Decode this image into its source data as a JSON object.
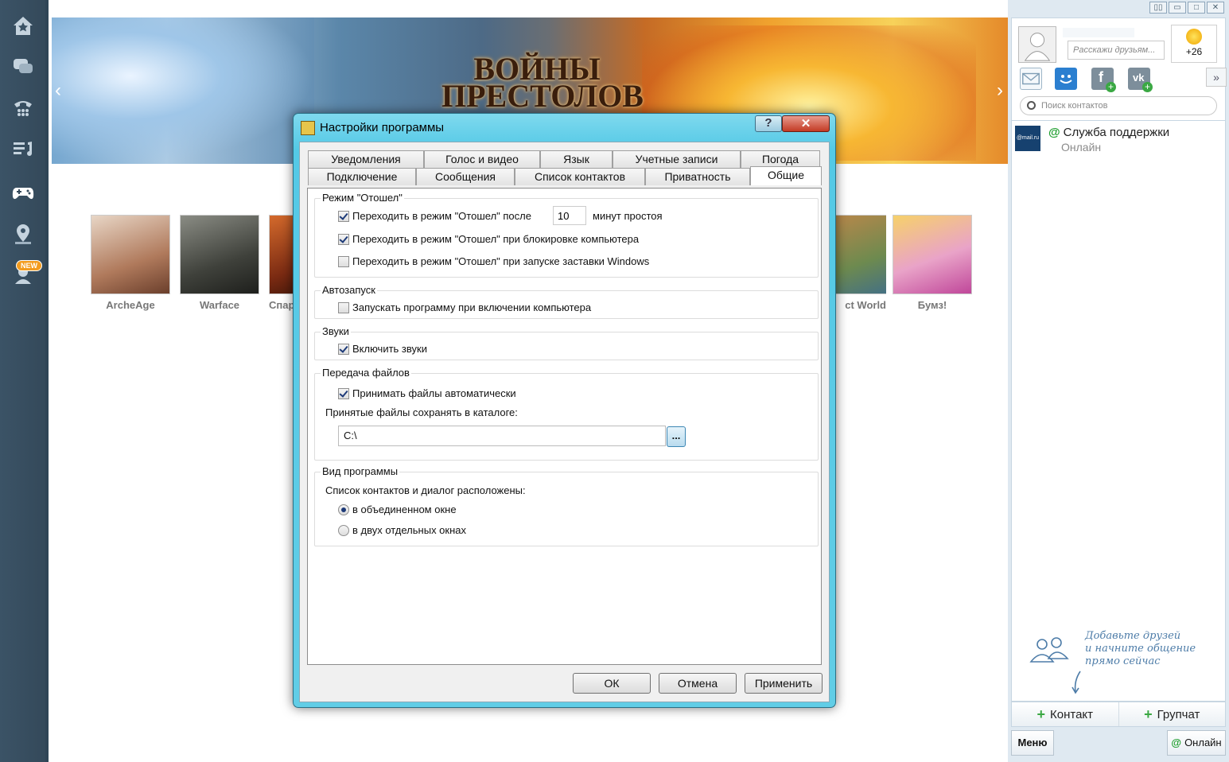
{
  "nav": {
    "new_badge": "NEW"
  },
  "banner": {
    "title_line1": "ВОЙНЫ",
    "title_line2": "ПРЕСТОЛОВ"
  },
  "games": [
    {
      "name": "ArcheAge",
      "color": "#c9a78c"
    },
    {
      "name": "Warface",
      "color": "#54574f"
    },
    {
      "name": "Спар",
      "color": "#8a3a1a"
    },
    {
      "name": "ct World",
      "color": "#6d8a4f"
    },
    {
      "name": "Бумз!",
      "color": "#e9a3c8"
    }
  ],
  "right_panel": {
    "status_placeholder": "Расскажи друзьям...",
    "weather_temp": "+26",
    "search_placeholder": "Поиск контактов",
    "contact": {
      "logo": "@mail.ru",
      "name": "Служба поддержки",
      "status": "Онлайн"
    },
    "hint": [
      "Добавьте друзей",
      "и начните общение",
      "прямо сейчас"
    ],
    "add_contact": "Контакт",
    "add_groupchat": "Групчат",
    "menu": "Меню",
    "online": "Онлайн"
  },
  "dialog": {
    "title": "Настройки программы",
    "help_label": "?",
    "close_label": "✕",
    "tabs_row1": [
      "Уведомления",
      "Голос и видео",
      "Язык",
      "Учетные записи",
      "Погода"
    ],
    "tabs_row2": [
      "Подключение",
      "Сообщения",
      "Список контактов",
      "Приватность",
      "Общие"
    ],
    "away": {
      "title": "Режим \"Отошел\"",
      "opt1": "Переходить в режим \"Отошел\" после",
      "opt1_checked": true,
      "minutes": "10",
      "minutes_suffix": "минут простоя",
      "opt2": "Переходить в режим \"Отошел\" при блокировке компьютера",
      "opt2_checked": true,
      "opt3": "Переходить в режим \"Отошел\" при запуске заставки Windows",
      "opt3_checked": false
    },
    "autostart": {
      "title": "Автозапуск",
      "opt": "Запускать программу при включении компьютера",
      "checked": false
    },
    "sounds": {
      "title": "Звуки",
      "opt": "Включить звуки",
      "checked": true
    },
    "files": {
      "title": "Передача файлов",
      "opt": "Принимать файлы автоматически",
      "checked": true,
      "dir_label": "Принятые файлы сохранять в каталоге:",
      "dir_value": "C:\\",
      "browse": "..."
    },
    "view": {
      "title": "Вид программы",
      "label": "Список контактов и диалог расположены:",
      "opt1": "в объединенном окне",
      "opt2": "в двух отдельных окнах",
      "selected": 1
    },
    "buttons": {
      "ok": "ОК",
      "cancel": "Отмена",
      "apply": "Применить"
    }
  }
}
